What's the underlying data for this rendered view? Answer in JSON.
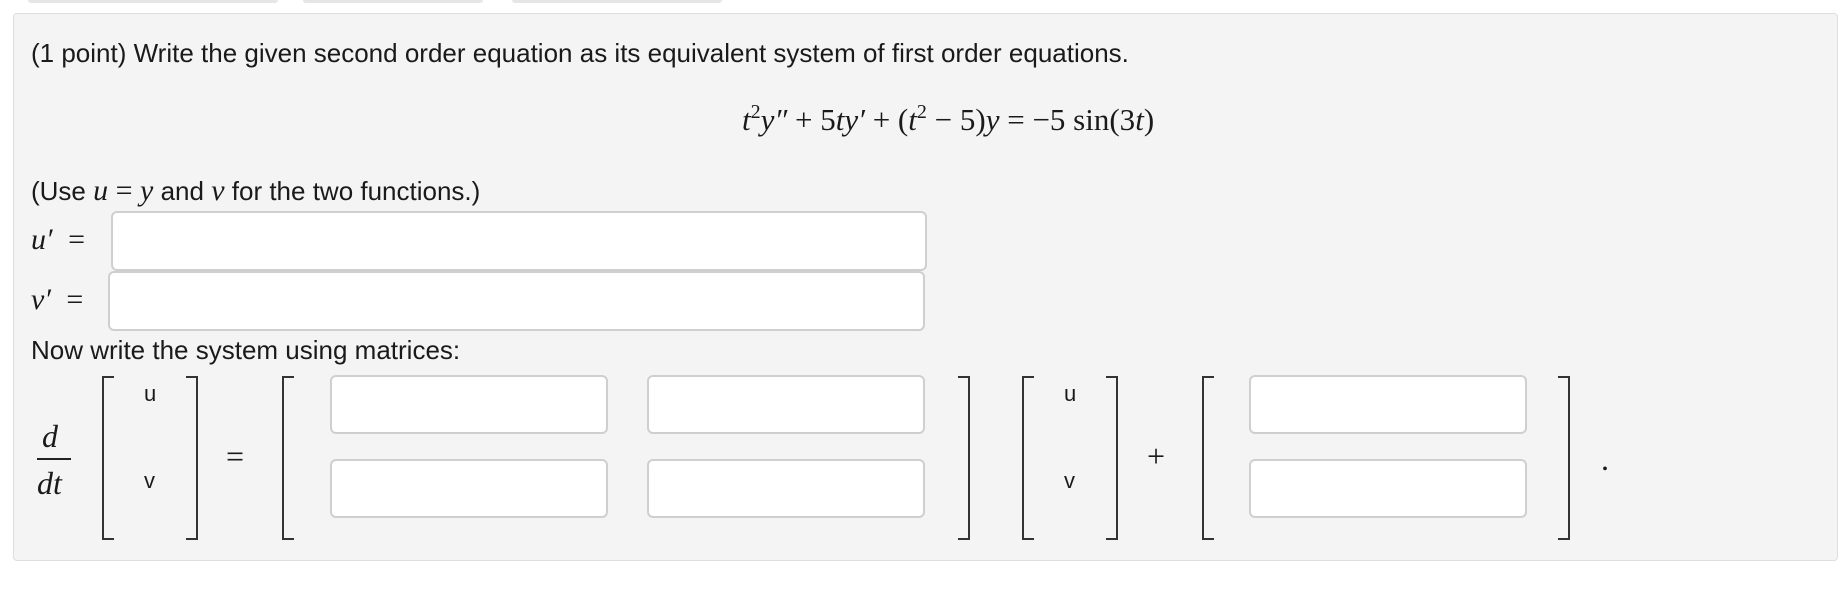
{
  "problem": {
    "prompt": "(1 point) Write the given second order equation as its equivalent system of first order equations.",
    "equation": {
      "t1": "t",
      "e1": "2",
      "y1": "y″",
      "p1": " + 5",
      "t2": "t",
      "y2": "y′",
      "p2": " + (",
      "t3": "t",
      "e2": "2",
      "p3": " − 5)",
      "y3": "y",
      "p4": " = −5 sin(3",
      "t4": "t",
      "p5": ")"
    },
    "hint": {
      "open": "(Use ",
      "u": "u",
      "eq": " = ",
      "y": "y",
      "and": " and ",
      "v": "v",
      "close": " for the two functions.)"
    },
    "u_prime_label": "u′",
    "v_prime_label": "v′",
    "equals": "=",
    "u_prime_value": "",
    "v_prime_value": "",
    "matrix_prompt": "Now write the system using matrices:",
    "matrix": {
      "d": "d",
      "dt": "dt",
      "vec_u": "u",
      "vec_v": "v",
      "equals": "=",
      "plus": "+",
      "period": "."
    }
  }
}
